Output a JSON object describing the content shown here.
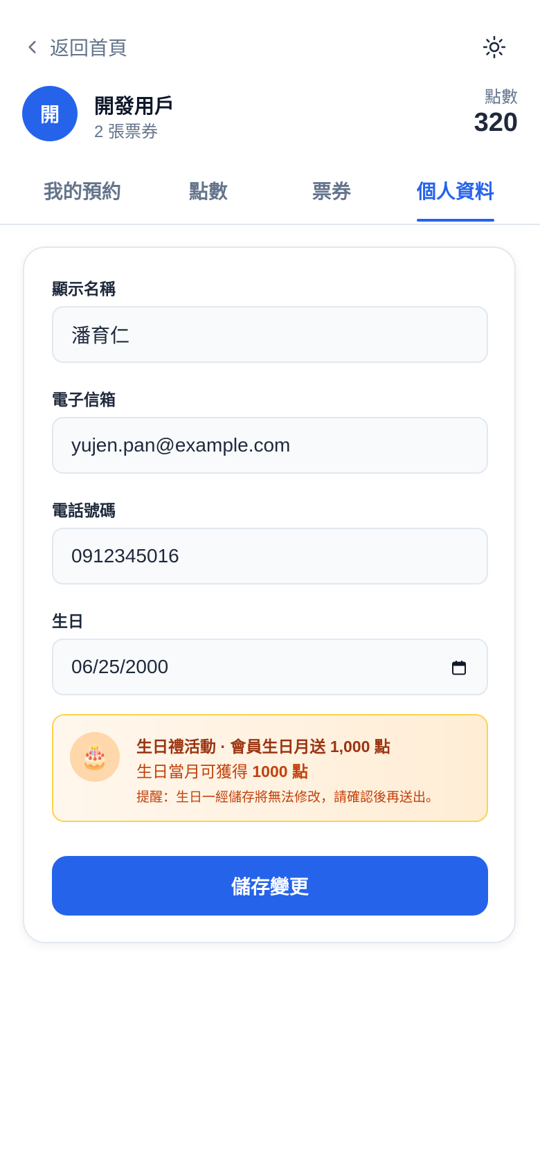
{
  "nav": {
    "back_label": "返回首頁",
    "back_icon": "chevron-left-icon",
    "theme_icon": "sun-icon"
  },
  "profile": {
    "avatar_initial": "開",
    "name": "開發用戶",
    "ticket_count": "2 張票券",
    "points_label": "點數",
    "points_value": "320"
  },
  "tabs": [
    {
      "label": "我的預約",
      "active": false
    },
    {
      "label": "點數",
      "active": false
    },
    {
      "label": "票券",
      "active": false
    },
    {
      "label": "個人資料",
      "active": true
    }
  ],
  "form": {
    "name_label": "顯示名稱",
    "name_value": "潘育仁",
    "email_label": "電子信箱",
    "email_value": "yujen.pan@example.com",
    "phone_label": "電話號碼",
    "phone_value": "0912345016",
    "birthday_label": "生日",
    "birthday_value": "06/25/2000",
    "calendar_icon": "calendar-icon"
  },
  "promo": {
    "icon": "🎂",
    "title": "生日禮活動 · 會員生日月送 1,000 點",
    "sub_prefix": "生日當月可獲得 ",
    "sub_points": "1000 點",
    "note": "提醒：生日一經儲存將無法修改，請確認後再送出。"
  },
  "save_label": "儲存變更",
  "colors": {
    "accent": "#2563eb",
    "promo_bg": "#fff7ed",
    "promo_border": "#fcd34d",
    "promo_text": "#9a3412"
  }
}
